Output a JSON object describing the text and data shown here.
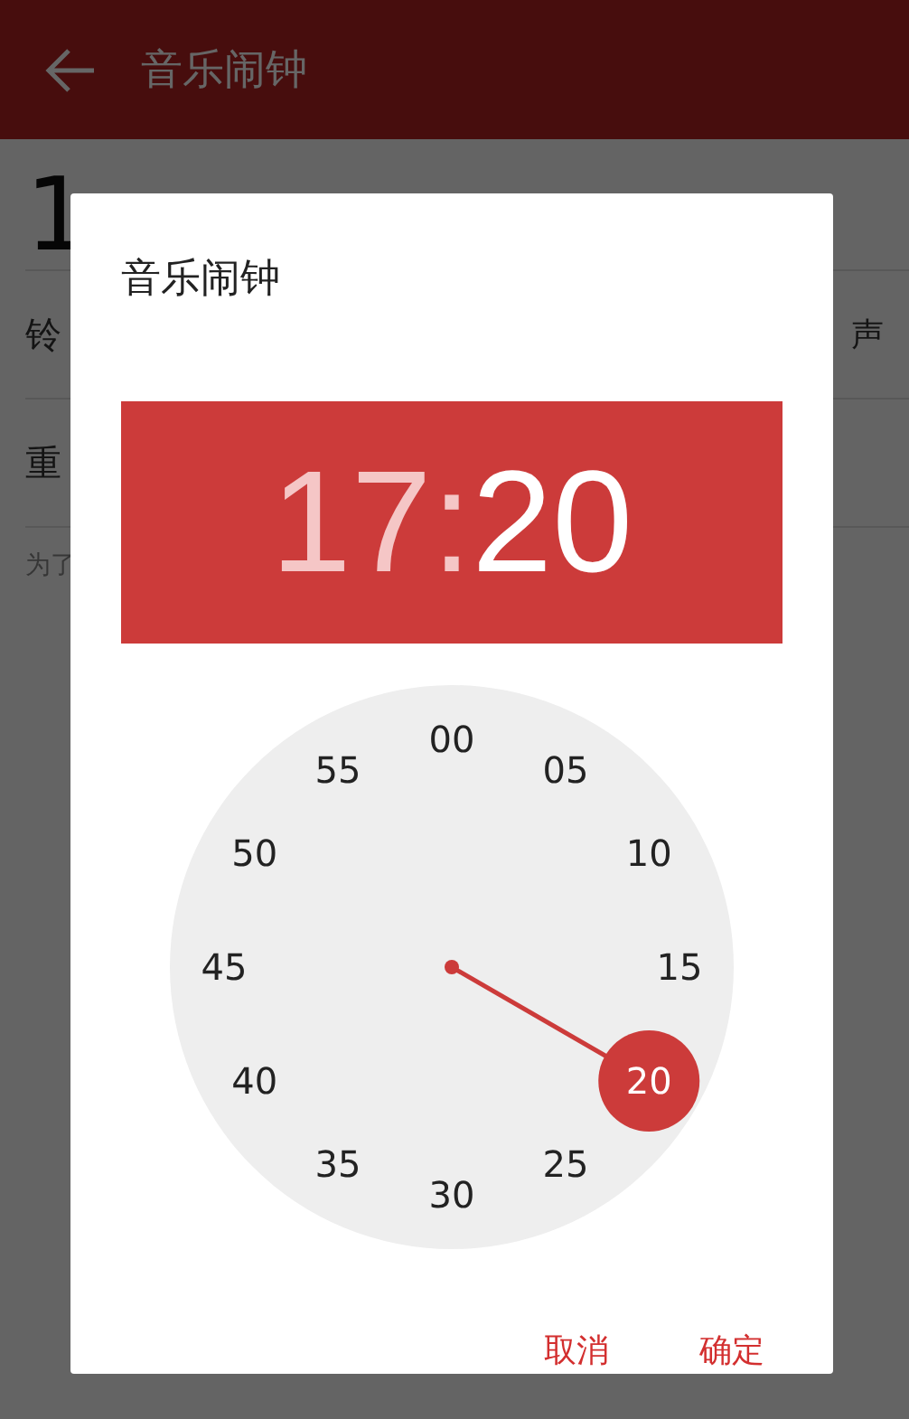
{
  "app_bar": {
    "title": "音乐闹钟"
  },
  "background": {
    "time": "1",
    "rows": [
      {
        "label": "铃",
        "value": "声"
      },
      {
        "label": "重"
      }
    ],
    "note": "为了"
  },
  "dialog": {
    "title": "音乐闹钟",
    "hour": {
      "text": "17",
      "selected": false
    },
    "separator": ":",
    "minute": {
      "text": "20",
      "selected": true
    },
    "dial": [
      {
        "label": "00",
        "selected": false
      },
      {
        "label": "05",
        "selected": false
      },
      {
        "label": "10",
        "selected": false
      },
      {
        "label": "15",
        "selected": false
      },
      {
        "label": "20",
        "selected": true
      },
      {
        "label": "25",
        "selected": false
      },
      {
        "label": "30",
        "selected": false
      },
      {
        "label": "35",
        "selected": false
      },
      {
        "label": "40",
        "selected": false
      },
      {
        "label": "45",
        "selected": false
      },
      {
        "label": "50",
        "selected": false
      },
      {
        "label": "55",
        "selected": false
      }
    ],
    "buttons": [
      "取消",
      "确定"
    ]
  }
}
